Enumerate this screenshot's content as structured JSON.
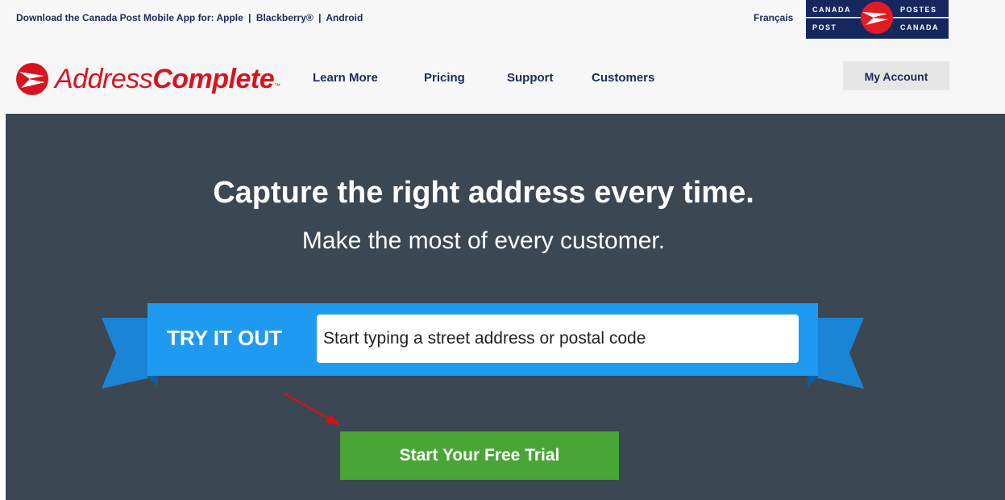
{
  "topbar": {
    "app_prefix": "Download the Canada Post Mobile App for:",
    "app_links": [
      "Apple",
      "Blackberry®",
      "Android"
    ],
    "separator": "|",
    "language_link": "Français"
  },
  "canada_post_logo": {
    "line1_left": "CANADA",
    "line1_right": "POSTES",
    "line2_left": "POST",
    "line2_right": "CANADA"
  },
  "header": {
    "brand_regular": "Address",
    "brand_bold": "Complete",
    "brand_tm": "™",
    "nav": [
      "Learn More",
      "Pricing",
      "Support",
      "Customers"
    ],
    "account_button": "My Account"
  },
  "hero": {
    "headline": "Capture the right address every time.",
    "subline": "Make the most of every customer.",
    "try_label": "TRY IT OUT",
    "input_placeholder": "Start typing a street address or postal code",
    "trial_button": "Start Your Free Trial"
  },
  "colors": {
    "brand_red": "#d9131d",
    "nav_text": "#1e2a5a",
    "hero_bg": "#3b4752",
    "ribbon_blue": "#1e9bf0",
    "cta_green": "#4aa537"
  }
}
